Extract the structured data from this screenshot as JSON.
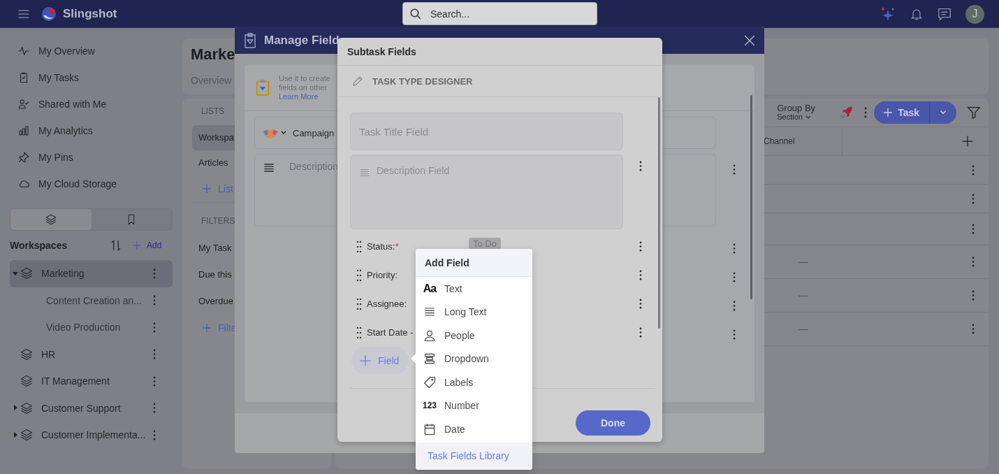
{
  "app": {
    "name": "Slingshot",
    "search": {
      "placeholder": "Search..."
    },
    "avatar": "J"
  },
  "sidebar": {
    "nav": [
      {
        "kind": "pulse",
        "label": "My Overview"
      },
      {
        "kind": "tasks",
        "label": "My Tasks"
      },
      {
        "kind": "shared",
        "label": "Shared with Me"
      },
      {
        "kind": "analytics",
        "label": "My Analytics"
      },
      {
        "kind": "pins",
        "label": "My Pins"
      },
      {
        "kind": "cloud",
        "label": "My Cloud Storage"
      }
    ],
    "tabs": [
      {
        "kind": "layers",
        "selected": true
      },
      {
        "kind": "bookmark",
        "selected": false
      }
    ],
    "workspaces": {
      "title": "Workspaces",
      "add": "Add",
      "items": [
        {
          "label": "Marketing",
          "expanded": true,
          "selected": true,
          "children": [
            {
              "label": "Content Creation an...",
              "selected": false
            },
            {
              "label": "Video Production",
              "selected": false
            }
          ]
        },
        {
          "label": "HR",
          "selected": false
        },
        {
          "label": "IT Management",
          "selected": false
        },
        {
          "label": "Customer Support",
          "expanded": false,
          "selected": false
        },
        {
          "label": "Customer Implementa...",
          "expanded": false,
          "selected": false
        }
      ]
    }
  },
  "page": {
    "title": "Marke",
    "tab": "Overview",
    "lists": {
      "title": "LISTS",
      "items": [
        {
          "label": "Workspa",
          "selected": true
        },
        {
          "label": "Articles",
          "selected": false
        }
      ],
      "add": "List"
    },
    "filters": {
      "title": "FILTERS",
      "items": [
        {
          "label": "My Task"
        },
        {
          "label": "Due this"
        },
        {
          "label": "Overdue"
        }
      ],
      "add": "Filte"
    },
    "toolbar": {
      "group_by": "Group By",
      "group_value": "Section",
      "add_task": "Task"
    },
    "table": {
      "columns": [
        "Channel"
      ],
      "rows": [
        {
          "kind": "blank"
        },
        {
          "kind": "blank"
        },
        {
          "kind": "blank"
        },
        {
          "kind": "dash",
          "channel": "—"
        },
        {
          "kind": "dash",
          "channel": "—"
        },
        {
          "kind": "dash",
          "channel": "—"
        }
      ]
    }
  },
  "manage_fields": {
    "title": "Manage Field",
    "info": [
      "Use it to create",
      "fields on other"
    ],
    "learn_more": "Learn More",
    "fields": [
      {
        "kind": "title",
        "label": "Campaign"
      },
      {
        "kind": "description",
        "label": "Description"
      }
    ]
  },
  "subtask_fields": {
    "title": "Subtask Fields",
    "section": "TASK TYPE DESIGNER",
    "title_field": {
      "placeholder": "Task Title Field"
    },
    "description_field": {
      "placeholder": "Description Field"
    },
    "rows": [
      {
        "label": "Status:",
        "mark": "*",
        "value": "To Do"
      },
      {
        "label": "Priority:"
      },
      {
        "label": "Assignee:"
      },
      {
        "label": "Start Date -"
      }
    ],
    "add_field": "Field",
    "done": "Done"
  },
  "add_field_menu": {
    "title": "Add Field",
    "items": [
      {
        "kind": "text",
        "glyph": "Aa",
        "label": "Text"
      },
      {
        "kind": "longtext",
        "label": "Long Text"
      },
      {
        "kind": "people",
        "label": "People"
      },
      {
        "kind": "dropdown",
        "label": "Dropdown"
      },
      {
        "kind": "labels",
        "label": "Labels"
      },
      {
        "kind": "number",
        "glyph": "123",
        "label": "Number"
      },
      {
        "kind": "date",
        "label": "Date"
      }
    ],
    "library": "Task Fields Library"
  }
}
